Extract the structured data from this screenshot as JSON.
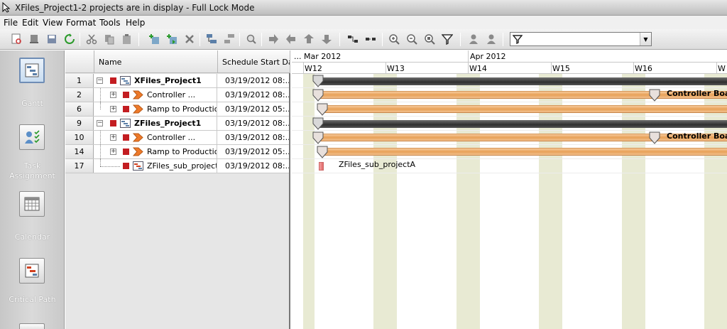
{
  "window": {
    "title": "XFiles_Project1-2 projects are in display - Full Lock Mode"
  },
  "menu": [
    "File",
    "Edit",
    "View",
    "Format",
    "Tools",
    "Help"
  ],
  "toolbar": {
    "filter_value": "",
    "icons": [
      "print-preview-icon",
      "stamp-icon",
      "save-icon",
      "refresh-icon",
      "cut-icon",
      "copy-icon",
      "paste-icon",
      "add-task-icon",
      "add-subtask-icon",
      "delete-icon",
      "indent-icon",
      "outdent-icon",
      "find-icon",
      "arrow-right-icon",
      "arrow-left-icon",
      "arrow-up-icon",
      "arrow-down-icon",
      "link-tasks-icon",
      "unlink-tasks-icon",
      "zoom-in-icon",
      "zoom-out-icon",
      "zoom-fit-icon",
      "filter-icon",
      "resource-icon",
      "assign-resource-icon"
    ]
  },
  "sidebar": {
    "views": [
      {
        "label": "Gantt",
        "icon": "gantt-view-icon",
        "active": true
      },
      {
        "label": "Task Assignment",
        "icon": "task-assignment-icon",
        "active": false
      },
      {
        "label": "Calendar",
        "icon": "calendar-icon",
        "active": false
      },
      {
        "label": "Critical Path",
        "icon": "critical-path-icon",
        "active": false
      }
    ]
  },
  "grid": {
    "columns": {
      "name": "Name",
      "start": "Schedule Start Date"
    },
    "rows": [
      {
        "id": "1",
        "name": "XFiles_Project1",
        "start": "03/19/2012 08:...",
        "bold": true
      },
      {
        "id": "2",
        "name": "Controller ...",
        "start": "03/19/2012 08:...",
        "bold": false
      },
      {
        "id": "6",
        "name": "Ramp to Production",
        "start": "03/19/2012 05:...",
        "bold": false
      },
      {
        "id": "9",
        "name": "ZFiles_Project1",
        "start": "03/19/2012 08:...",
        "bold": true
      },
      {
        "id": "10",
        "name": "Controller ...",
        "start": "03/19/2012 08:...",
        "bold": false
      },
      {
        "id": "14",
        "name": "Ramp to Production",
        "start": "03/19/2012 05:...",
        "bold": false
      },
      {
        "id": "17",
        "name": "ZFiles_sub_projectA",
        "start": "03/19/2012 08:...",
        "bold": false
      }
    ]
  },
  "gantt": {
    "months": [
      "... Mar 2012",
      "Apr 2012"
    ],
    "weeks": [
      "W12",
      "W13",
      "W14",
      "W15",
      "W16",
      "W"
    ],
    "bar_labels": {
      "row2": "Controller Board",
      "row10": "Controller Board",
      "row17": "ZFiles_sub_projectA"
    }
  }
}
